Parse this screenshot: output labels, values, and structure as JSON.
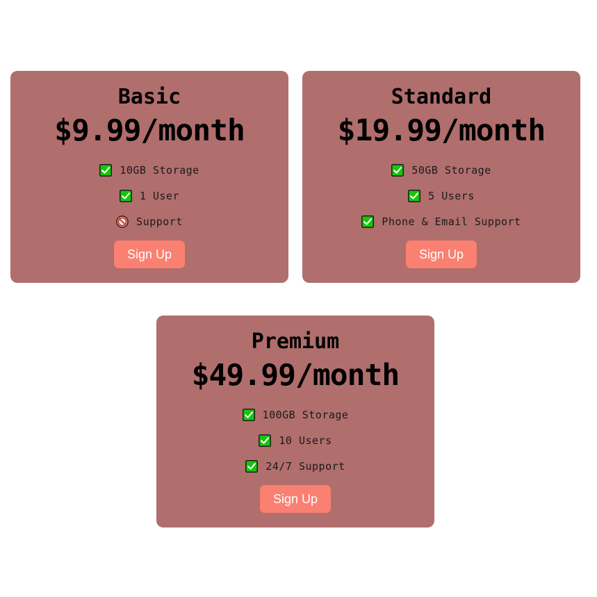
{
  "plans": [
    {
      "name": "Basic",
      "price": "$9.99/month",
      "features": [
        {
          "icon": "check-icon",
          "included": true,
          "text": "10GB Storage"
        },
        {
          "icon": "check-icon",
          "included": true,
          "text": "1 User"
        },
        {
          "icon": "prohibited-icon",
          "included": false,
          "text": "Support"
        }
      ],
      "button_label": "Sign Up"
    },
    {
      "name": "Standard",
      "price": "$19.99/month",
      "features": [
        {
          "icon": "check-icon",
          "included": true,
          "text": "50GB Storage"
        },
        {
          "icon": "check-icon",
          "included": true,
          "text": "5 Users"
        },
        {
          "icon": "check-icon",
          "included": true,
          "text": "Phone & Email Support"
        }
      ],
      "button_label": "Sign Up"
    },
    {
      "name": "Premium",
      "price": "$49.99/month",
      "features": [
        {
          "icon": "check-icon",
          "included": true,
          "text": "100GB Storage"
        },
        {
          "icon": "check-icon",
          "included": true,
          "text": "10 Users"
        },
        {
          "icon": "check-icon",
          "included": true,
          "text": "24/7 Support"
        }
      ],
      "button_label": "Sign Up"
    }
  ],
  "colors": {
    "card_background": "#b06e6d",
    "button_background": "#fa8072",
    "button_text": "#ffffff",
    "check_green": "#16c60c"
  }
}
